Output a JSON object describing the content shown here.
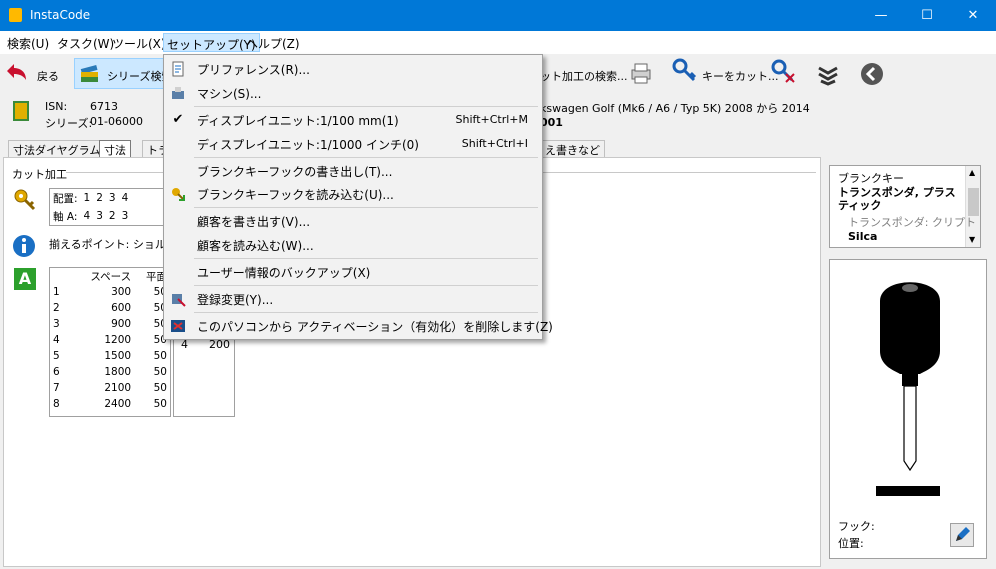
{
  "window": {
    "title": "InstaCode",
    "min": "—",
    "max": "☐",
    "close": "✕"
  },
  "menubar": {
    "items": [
      "検索(U)",
      "タスク(W)",
      "ツール(X)",
      "セットアップ(Y)",
      "ヘルプ(Z)"
    ]
  },
  "toolbar": {
    "back": "戻る",
    "series_search": "シリーズ検索",
    "cut_search": "ット加工の検索...",
    "cut_key": "キーをカット..."
  },
  "info": {
    "isn_label": "ISN:",
    "isn_value": "6713",
    "series_label": "シリーズ:",
    "series_value": "01-06000",
    "vehicle": "kswagen Golf (Mk6 / A6 / Typ 5K) 2008 から 2014",
    "code_tail": "001"
  },
  "tabs": [
    "寸法ダイヤグラム",
    "寸法",
    "トラ",
    "え書きなど"
  ],
  "cut_section": {
    "title": "カット加工",
    "row1_label": "配置:",
    "row1_values": [
      "1",
      "2",
      "3",
      "4"
    ],
    "row2_label": "軸 A:",
    "row2_values": [
      "4",
      "3",
      "2",
      "3"
    ],
    "align_point": "揃えるポイント: ショルダー"
  },
  "space_table": {
    "headers": [
      "スペース",
      "平面"
    ],
    "rows": [
      [
        "1",
        "300",
        "50"
      ],
      [
        "2",
        "600",
        "50"
      ],
      [
        "3",
        "900",
        "50"
      ],
      [
        "4",
        "1200",
        "50"
      ],
      [
        "5",
        "1500",
        "50"
      ],
      [
        "6",
        "1800",
        "50"
      ],
      [
        "7",
        "2100",
        "50"
      ],
      [
        "8",
        "2400",
        "50"
      ]
    ],
    "second_row": [
      "4",
      "200"
    ]
  },
  "blank_key": {
    "title": "ブランクキー",
    "item1": "トランスポンダ, プラスティック",
    "item2": "トランスポンダ: クリプト",
    "item3": "Silca",
    "hook_label": "フック:",
    "position_label": "位置:"
  },
  "dropdown": {
    "items": [
      {
        "label": "プリファレンス(R)...",
        "shortcut": ""
      },
      {
        "label": "マシン(S)...",
        "shortcut": ""
      },
      {
        "label": "ディスプレイユニット:1/100 mm(1)",
        "shortcut": "Shift+Ctrl+M"
      },
      {
        "label": "ディスプレイユニット:1/1000 インチ(0)",
        "shortcut": "Shift+Ctrl+I"
      },
      {
        "label": "ブランクキーフックの書き出し(T)...",
        "shortcut": ""
      },
      {
        "label": "ブランクキーフックを読み込む(U)...",
        "shortcut": ""
      },
      {
        "label": "顧客を書き出す(V)...",
        "shortcut": ""
      },
      {
        "label": "顧客を読み込む(W)...",
        "shortcut": ""
      },
      {
        "label": "ユーザー情報のバックアップ(X)",
        "shortcut": ""
      },
      {
        "label": "登録変更(Y)...",
        "shortcut": ""
      },
      {
        "label": "このパソコンから アクティベーション（有効化）を削除します(Z)",
        "shortcut": ""
      }
    ],
    "checked_index": 2
  }
}
